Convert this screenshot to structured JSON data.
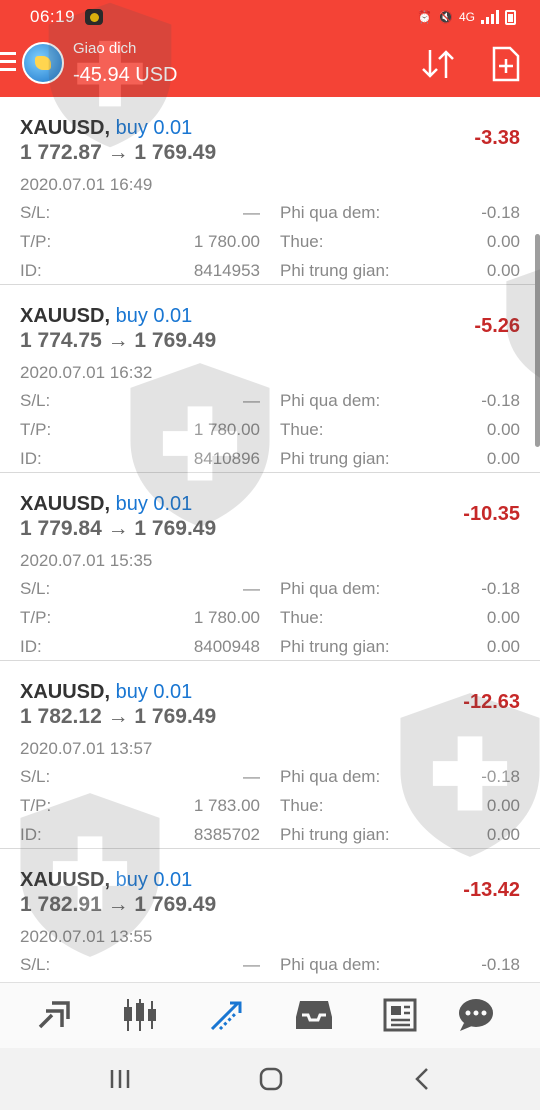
{
  "status_bar": {
    "time": "06:19",
    "network": "4G"
  },
  "header": {
    "title": "Giao dich",
    "balance": "-45.94 USD"
  },
  "positions": [
    {
      "symbol": "XAUUSD,",
      "side": "buy 0.01",
      "prices": "1 772.87 → 1 769.49",
      "profit": "-3.38",
      "datetime": "2020.07.01 16:49",
      "sl_label": "S/L:",
      "sl": "—",
      "tp_label": "T/P:",
      "tp": "1 780.00",
      "id_label": "ID:",
      "id": "8414953",
      "swap_label": "Phi qua dem:",
      "swap": "-0.18",
      "tax_label": "Thue:",
      "tax": "0.00",
      "comm_label": "Phi trung gian:",
      "comm": "0.00"
    },
    {
      "symbol": "XAUUSD,",
      "side": "buy 0.01",
      "prices": "1 774.75 → 1 769.49",
      "profit": "-5.26",
      "datetime": "2020.07.01 16:32",
      "sl_label": "S/L:",
      "sl": "—",
      "tp_label": "T/P:",
      "tp": "1 780.00",
      "id_label": "ID:",
      "id": "8410896",
      "swap_label": "Phi qua dem:",
      "swap": "-0.18",
      "tax_label": "Thue:",
      "tax": "0.00",
      "comm_label": "Phi trung gian:",
      "comm": "0.00"
    },
    {
      "symbol": "XAUUSD,",
      "side": "buy 0.01",
      "prices": "1 779.84 → 1 769.49",
      "profit": "-10.35",
      "datetime": "2020.07.01 15:35",
      "sl_label": "S/L:",
      "sl": "—",
      "tp_label": "T/P:",
      "tp": "1 780.00",
      "id_label": "ID:",
      "id": "8400948",
      "swap_label": "Phi qua dem:",
      "swap": "-0.18",
      "tax_label": "Thue:",
      "tax": "0.00",
      "comm_label": "Phi trung gian:",
      "comm": "0.00"
    },
    {
      "symbol": "XAUUSD,",
      "side": "buy 0.01",
      "prices": "1 782.12 → 1 769.49",
      "profit": "-12.63",
      "datetime": "2020.07.01 13:57",
      "sl_label": "S/L:",
      "sl": "—",
      "tp_label": "T/P:",
      "tp": "1 783.00",
      "id_label": "ID:",
      "id": "8385702",
      "swap_label": "Phi qua dem:",
      "swap": "-0.18",
      "tax_label": "Thue:",
      "tax": "0.00",
      "comm_label": "Phi trung gian:",
      "comm": "0.00"
    },
    {
      "symbol": "XAUUSD,",
      "side": "buy 0.01",
      "prices": "1 782.91 → 1 769.49",
      "profit": "-13.42",
      "datetime": "2020.07.01 13:55",
      "sl_label": "S/L:",
      "sl": "—",
      "swap_label": "Phi qua dem:",
      "swap": "-0.18"
    }
  ],
  "bottom_nav": [
    "quotes-icon",
    "chart-candles-icon",
    "trade-icon",
    "history-inbox-icon",
    "news-icon",
    "chat-icon"
  ],
  "colors": {
    "header": "#f44336",
    "loss": "#c62828",
    "buy": "#1976d2",
    "active_tab": "#1976d2"
  }
}
